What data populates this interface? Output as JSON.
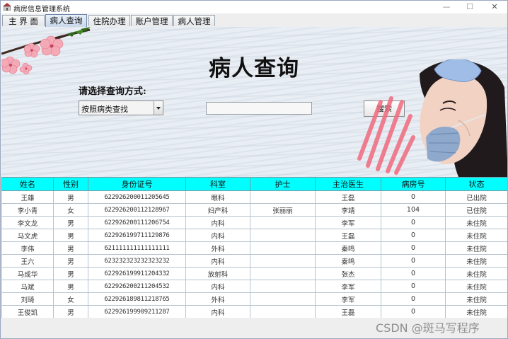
{
  "window": {
    "title": "病房信息管理系统",
    "min_label": "—",
    "max_label": "☐",
    "close_label": "✕"
  },
  "tabs": [
    {
      "label": "主 界 面"
    },
    {
      "label": "病人查询",
      "active": true
    },
    {
      "label": "住院办理"
    },
    {
      "label": "账户管理"
    },
    {
      "label": "病人管理"
    }
  ],
  "query_panel": {
    "title": "病人查询",
    "method_label": "请选择查询方式:",
    "method_selected": "按照病类查找",
    "search_value": "",
    "search_button": "搜索"
  },
  "table": {
    "headers": [
      "姓名",
      "性别",
      "身份证号",
      "科室",
      "护士",
      "主治医生",
      "病房号",
      "状态"
    ],
    "rows": [
      [
        "王雄",
        "男",
        "622926200011205645",
        "眼科",
        "",
        "王磊",
        "0",
        "已出院"
      ],
      [
        "李小青",
        "女",
        "622926200112128967",
        "妇产科",
        "张丽丽",
        "李靖",
        "104",
        "已住院"
      ],
      [
        "李文龙",
        "男",
        "622926200111206754",
        "内科",
        "",
        "李军",
        "0",
        "未住院"
      ],
      [
        "马文虎",
        "男",
        "622926199711129876",
        "内科",
        "",
        "王磊",
        "0",
        "未住院"
      ],
      [
        "李伟",
        "男",
        "621111111111111111",
        "外科",
        "",
        "秦鸣",
        "0",
        "未住院"
      ],
      [
        "王六",
        "男",
        "623232323232323232",
        "内科",
        "",
        "秦鸣",
        "0",
        "未住院"
      ],
      [
        "马成华",
        "男",
        "622926199911204332",
        "放射科",
        "",
        "张杰",
        "0",
        "未住院"
      ],
      [
        "马斌",
        "男",
        "622926200211204532",
        "内科",
        "",
        "李军",
        "0",
        "未住院"
      ],
      [
        "刘琦",
        "女",
        "622926189811218765",
        "外科",
        "",
        "李军",
        "0",
        "未住院"
      ],
      [
        "王俊凯",
        "男",
        "622926199909211287",
        "内科",
        "",
        "王磊",
        "0",
        "未住院"
      ]
    ]
  },
  "watermark": "CSDN @斑马写程序",
  "colors": {
    "header_bg": "#00ffff",
    "tab_active": "#c9d8ea"
  }
}
